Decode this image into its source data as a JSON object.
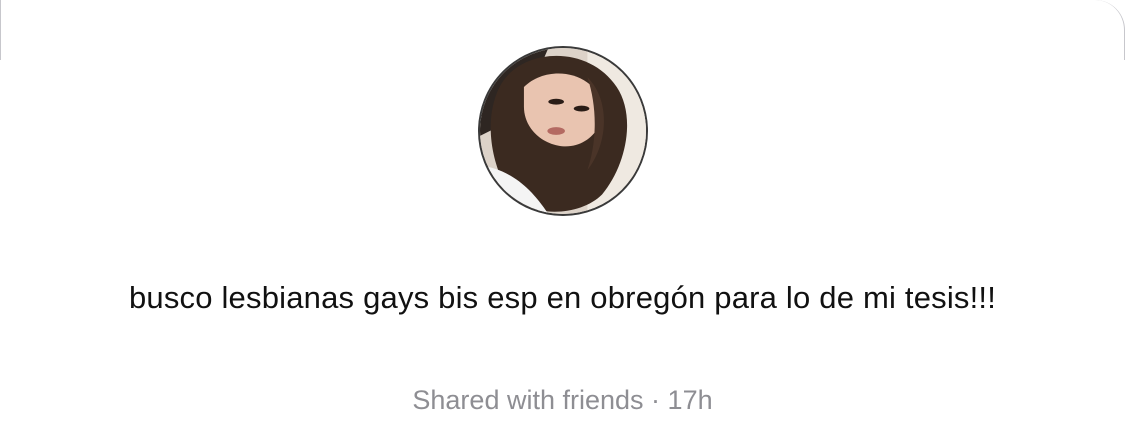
{
  "post": {
    "text": "busco lesbianas gays bis esp en obregón para lo de mi tesis!!!",
    "audience": "Shared with friends",
    "separator": "·",
    "time": "17h"
  },
  "avatar": {
    "icon": "profile-photo",
    "colors": {
      "background": "#e8e2dc",
      "hair": "#3b2a20",
      "skin": "#e9c4b0",
      "shirt": "#f4f4f4"
    }
  },
  "colors": {
    "text": "#111111",
    "meta": "#8e8e93"
  }
}
